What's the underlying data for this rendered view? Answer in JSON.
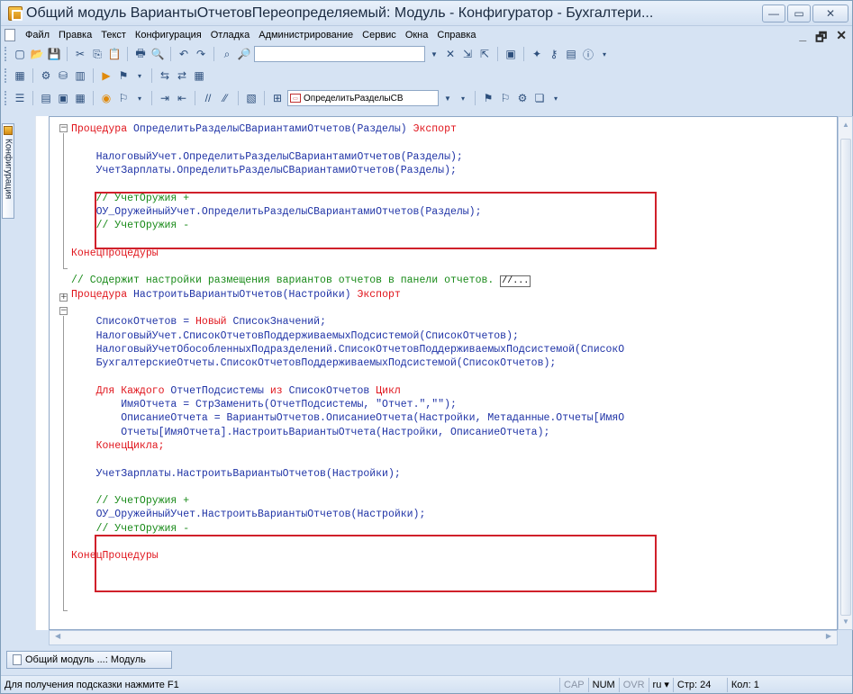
{
  "window": {
    "title": "Общий модуль ВариантыОтчетовПереопределяемый: Модуль - Конфигуратор - Бухгалтери...",
    "controls": [
      "—",
      "▭",
      "✕"
    ]
  },
  "menu": {
    "items": [
      "Файл",
      "Правка",
      "Текст",
      "Конфигурация",
      "Отладка",
      "Администрирование",
      "Сервис",
      "Окна",
      "Справка"
    ],
    "right_controls": [
      "_",
      "🗗",
      "✕"
    ]
  },
  "toolbar": {
    "search_value": "",
    "procedure_combo": "ОпределитьРазделыСВ"
  },
  "side_tab": {
    "label": "Конфигурация"
  },
  "editor": {
    "lines": [
      {
        "parts": [
          {
            "c": "kw",
            "t": "Процедура "
          },
          {
            "c": "id",
            "t": "ОпределитьРазделыСВариантамиОтчетов(Разделы) "
          },
          {
            "c": "kw",
            "t": "Экспорт"
          }
        ]
      },
      {
        "parts": []
      },
      {
        "parts": [
          {
            "c": "id",
            "t": "    НалоговыйУчет.ОпределитьРазделыСВариантамиОтчетов(Разделы);"
          }
        ]
      },
      {
        "parts": [
          {
            "c": "id",
            "t": "    УчетЗарплаты.ОпределитьРазделыСВариантамиОтчетов(Разделы);"
          }
        ]
      },
      {
        "parts": []
      },
      {
        "parts": [
          {
            "c": "cm",
            "t": "    // УчетОружия +"
          }
        ]
      },
      {
        "parts": [
          {
            "c": "id",
            "t": "    ОУ_ОружейныйУчет.ОпределитьРазделыСВариантамиОтчетов(Разделы);"
          }
        ]
      },
      {
        "parts": [
          {
            "c": "cm",
            "t": "    // УчетОружия -"
          }
        ]
      },
      {
        "parts": []
      },
      {
        "parts": [
          {
            "c": "kw",
            "t": "КонецПроцедуры"
          }
        ]
      },
      {
        "parts": []
      },
      {
        "parts": [
          {
            "c": "cm",
            "t": "// Содержит настройки размещения вариантов отчетов в панели отчетов. "
          }
        ],
        "collapsed": "//..."
      },
      {
        "parts": [
          {
            "c": "kw",
            "t": "Процедура "
          },
          {
            "c": "id",
            "t": "НастроитьВариантыОтчетов(Настройки) "
          },
          {
            "c": "kw",
            "t": "Экспорт"
          }
        ]
      },
      {
        "parts": []
      },
      {
        "parts": [
          {
            "c": "id",
            "t": "    СписокОтчетов = "
          },
          {
            "c": "kw",
            "t": "Новый "
          },
          {
            "c": "id",
            "t": "СписокЗначений;"
          }
        ]
      },
      {
        "parts": [
          {
            "c": "id",
            "t": "    НалоговыйУчет.СписокОтчетовПоддерживаемыхПодсистемой(СписокОтчетов);"
          }
        ]
      },
      {
        "parts": [
          {
            "c": "id",
            "t": "    НалоговыйУчетОбособленныхПодразделений.СписокОтчетовПоддерживаемыхПодсистемой(СписокО"
          }
        ]
      },
      {
        "parts": [
          {
            "c": "id",
            "t": "    БухгалтерскиеОтчеты.СписокОтчетовПоддерживаемыхПодсистемой(СписокОтчетов);"
          }
        ]
      },
      {
        "parts": []
      },
      {
        "parts": [
          {
            "c": "kw",
            "t": "    Для Каждого "
          },
          {
            "c": "id",
            "t": "ОтчетПодсистемы "
          },
          {
            "c": "kw",
            "t": "из "
          },
          {
            "c": "id",
            "t": "СписокОтчетов "
          },
          {
            "c": "kw",
            "t": "Цикл"
          }
        ]
      },
      {
        "parts": [
          {
            "c": "id",
            "t": "        ИмяОтчета = СтрЗаменить(ОтчетПодсистемы, "
          },
          {
            "c": "st",
            "t": "\"Отчет.\",\"\""
          },
          {
            "c": "id",
            "t": ");"
          }
        ]
      },
      {
        "parts": [
          {
            "c": "id",
            "t": "        ОписаниеОтчета = ВариантыОтчетов.ОписаниеОтчета(Настройки, Метаданные.Отчеты[ИмяО"
          }
        ]
      },
      {
        "parts": [
          {
            "c": "id",
            "t": "        Отчеты[ИмяОтчета].НастроитьВариантыОтчета(Настройки, ОписаниеОтчета);"
          }
        ]
      },
      {
        "parts": [
          {
            "c": "kw",
            "t": "    КонецЦикла;"
          }
        ]
      },
      {
        "parts": []
      },
      {
        "parts": [
          {
            "c": "id",
            "t": "    УчетЗарплаты.НастроитьВариантыОтчетов(Настройки);"
          }
        ]
      },
      {
        "parts": []
      },
      {
        "parts": [
          {
            "c": "cm",
            "t": "    // УчетОружия +"
          }
        ]
      },
      {
        "parts": [
          {
            "c": "id",
            "t": "    ОУ_ОружейныйУчет.НастроитьВариантыОтчетов(Настройки);"
          }
        ]
      },
      {
        "parts": [
          {
            "c": "cm",
            "t": "    // УчетОружия -"
          }
        ]
      },
      {
        "parts": []
      },
      {
        "parts": [
          {
            "c": "kw",
            "t": "КонецПроцедуры"
          }
        ]
      }
    ]
  },
  "bottom_tab": {
    "label": "Общий модуль ...: Модуль"
  },
  "status": {
    "hint": "Для получения подсказки нажмите F1",
    "cap": "CAP",
    "num": "NUM",
    "ovr": "OVR",
    "lang": "ru ▾",
    "line": "Стр: 24",
    "col": "Кол: 1"
  }
}
